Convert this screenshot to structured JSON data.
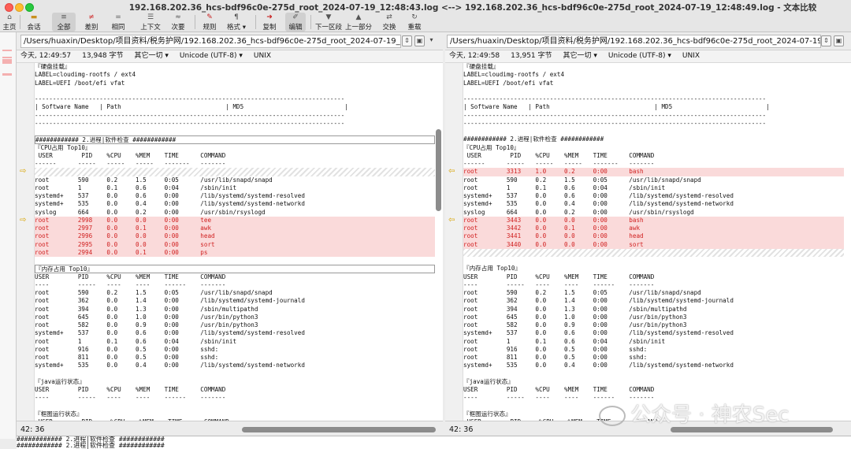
{
  "window": {
    "title": "192.168.202.36_hcs-bdf96c0e-275d_root_2024-07-19_12:48:43.log <--> 192.168.202.36_hcs-bdf96c0e-275d_root_2024-07-19_12:48:49.log - 文本比较"
  },
  "toolbar": [
    {
      "label": "主页",
      "icon": "home-icon"
    },
    {
      "label": "会话",
      "icon": "session-icon"
    },
    {
      "label": "全部",
      "icon": "all-icon"
    },
    {
      "label": "差别",
      "icon": "diff-icon"
    },
    {
      "label": "相同",
      "icon": "same-icon"
    },
    {
      "label": "上下文",
      "icon": "context-icon"
    },
    {
      "label": "次要",
      "icon": "minor-icon"
    },
    {
      "label": "规则",
      "icon": "rules-icon"
    },
    {
      "label": "格式",
      "icon": "format-icon"
    },
    {
      "label": "复制",
      "icon": "copy-icon"
    },
    {
      "label": "编辑",
      "icon": "edit-icon"
    },
    {
      "label": "下一区段",
      "icon": "next-section-icon"
    },
    {
      "label": "上一部分",
      "icon": "prev-section-icon"
    },
    {
      "label": "交换",
      "icon": "swap-icon"
    },
    {
      "label": "重载",
      "icon": "reload-icon"
    }
  ],
  "left": {
    "path": "/Users/huaxin/Desktop/项目资料/税务护网/192.168.202.36_hcs-bdf96c0e-275d_root_2024-07-19_12:48:43.log",
    "time": "今天, 12:49:57",
    "size": "13,948 字节",
    "other": "其它一切 ▾",
    "encoding": "Unicode (UTF-8) ▾",
    "eol": "UNIX",
    "cursor": "42: 36",
    "lines": [
      {
        "t": "『硬盘挂载』"
      },
      {
        "t": "LABEL=cloudimg-rootfs / ext4"
      },
      {
        "t": "LABEL=UEFI /boot/efi vfat"
      },
      {
        "t": ""
      },
      {
        "t": "--------------------------------------------------------------------------------------"
      },
      {
        "t": "| Software Name   | Path                             | MD5                            |"
      },
      {
        "t": "--------------------------------------------------------------------------------------"
      },
      {
        "t": "--------------------------------------------------------------------------------------"
      },
      {
        "t": ""
      },
      {
        "t": "############ 2.进程|软件检查 ############",
        "k": "box"
      },
      {
        "t": "『CPU占用 Top10』"
      },
      {
        "t": " USER        PID    %CPU    %MEM    TIME      COMMAND"
      },
      {
        "t": "------      -----   -----   -----   -------   -------"
      },
      {
        "t": "",
        "k": "hatch",
        "a": true
      },
      {
        "t": "root        590     0.2     1.5     0:05      /usr/lib/snapd/snapd"
      },
      {
        "t": "root        1       0.1     0.6     0:04      /sbin/init"
      },
      {
        "t": "systemd+    537     0.0     0.6     0:00      /lib/systemd/systemd-resolved"
      },
      {
        "t": "systemd+    535     0.0     0.4     0:00      /lib/systemd/systemd-networkd"
      },
      {
        "t": "syslog      664     0.0     0.2     0:00      /usr/sbin/rsyslogd"
      },
      {
        "t": "root        2998    0.0     0.0     0:00      tee",
        "k": "diff",
        "a": true
      },
      {
        "t": "root        2997    0.0     0.1     0:00      awk",
        "k": "diff"
      },
      {
        "t": "root        2996    0.0     0.0     0:00      head",
        "k": "diff"
      },
      {
        "t": "root        2995    0.0     0.0     0:00      sort",
        "k": "diff"
      },
      {
        "t": "root        2994    0.0     0.1     0:00      ps",
        "k": "diff"
      },
      {
        "t": ""
      },
      {
        "t": "『内存占用 Top10』",
        "k": "box"
      },
      {
        "t": "USER        PID     %CPU    %MEM    TIME      COMMAND"
      },
      {
        "t": "----        -----   ----    ----    ------    -------"
      },
      {
        "t": "root        590     0.2     1.5     0:05      /usr/lib/snapd/snapd"
      },
      {
        "t": "root        362     0.0     1.4     0:00      /lib/systemd/systemd-journald"
      },
      {
        "t": "root        394     0.0     1.3     0:00      /sbin/multipathd"
      },
      {
        "t": "root        645     0.0     1.0     0:00      /usr/bin/python3"
      },
      {
        "t": "root        582     0.0     0.9     0:00      /usr/bin/python3"
      },
      {
        "t": "systemd+    537     0.0     0.6     0:00      /lib/systemd/systemd-resolved"
      },
      {
        "t": "root        1       0.1     0.6     0:04      /sbin/init"
      },
      {
        "t": "root        916     0.0     0.5     0:00      sshd:"
      },
      {
        "t": "root        811     0.0     0.5     0:00      sshd:"
      },
      {
        "t": "systemd+    535     0.0     0.4     0:00      /lib/systemd/systemd-networkd"
      },
      {
        "t": ""
      },
      {
        "t": "『java运行状态』"
      },
      {
        "t": "USER        PID     %CPU    %MEM    TIME      COMMAND"
      },
      {
        "t": "----        -----   ----    ----    ------    -------"
      },
      {
        "t": ""
      },
      {
        "t": "『框图运行状态』"
      },
      {
        "t": " USER        PID     %CPU    %MEM    TIME      COMMAND"
      }
    ]
  },
  "right": {
    "path": "/Users/huaxin/Desktop/项目资料/税务护网/192.168.202.36_hcs-bdf96c0e-275d_root_2024-07-19_12:48:49.log",
    "time": "今天, 12:49:58",
    "size": "13,951 字节",
    "other": "其它一切 ▾",
    "encoding": "Unicode (UTF-8) ▾",
    "eol": "UNIX",
    "cursor": "42: 36",
    "lines": [
      {
        "t": "『硬盘挂载』"
      },
      {
        "t": "LABEL=cloudimg-rootfs / ext4"
      },
      {
        "t": "LABEL=UEFI /boot/efi vfat"
      },
      {
        "t": ""
      },
      {
        "t": "------------------------------------------------------------------------------------"
      },
      {
        "t": "| Software Name   | Path                             | MD5                          |"
      },
      {
        "t": "------------------------------------------------------------------------------------"
      },
      {
        "t": "------------------------------------------------------------------------------------"
      },
      {
        "t": ""
      },
      {
        "t": "############ 2.进程|软件检查 ############"
      },
      {
        "t": "『CPU占用 Top10』"
      },
      {
        "t": " USER        PID    %CPU    %MEM    TIME      COMMAND"
      },
      {
        "t": "------      -----   -----   -----   -------   -------"
      },
      {
        "t": "root        3313    1.0     0.2     0:00      bash",
        "k": "diff",
        "a": true
      },
      {
        "t": "root        590     0.2     1.5     0:05      /usr/lib/snapd/snapd"
      },
      {
        "t": "root        1       0.1     0.6     0:04      /sbin/init"
      },
      {
        "t": "systemd+    537     0.0     0.6     0:00      /lib/systemd/systemd-resolved"
      },
      {
        "t": "systemd+    535     0.0     0.4     0:00      /lib/systemd/systemd-networkd"
      },
      {
        "t": "syslog      664     0.0     0.2     0:00      /usr/sbin/rsyslogd"
      },
      {
        "t": "root        3443    0.0     0.0     0:00      bash",
        "k": "diff",
        "a": true
      },
      {
        "t": "root        3442    0.0     0.1     0:00      awk",
        "k": "diff"
      },
      {
        "t": "root        3441    0.0     0.0     0:00      head",
        "k": "diff"
      },
      {
        "t": "root        3440    0.0     0.0     0:00      sort",
        "k": "diff"
      },
      {
        "t": "",
        "k": "hatch"
      },
      {
        "t": ""
      },
      {
        "t": "『内存占用 Top10』"
      },
      {
        "t": "USER        PID     %CPU    %MEM    TIME      COMMAND"
      },
      {
        "t": "----        -----   ----    ----    ------    -------"
      },
      {
        "t": "root        590     0.2     1.5     0:05      /usr/lib/snapd/snapd"
      },
      {
        "t": "root        362     0.0     1.4     0:00      /lib/systemd/systemd-journald"
      },
      {
        "t": "root        394     0.0     1.3     0:00      /sbin/multipathd"
      },
      {
        "t": "root        645     0.0     1.0     0:00      /usr/bin/python3"
      },
      {
        "t": "root        582     0.0     0.9     0:00      /usr/bin/python3"
      },
      {
        "t": "systemd+    537     0.0     0.6     0:00      /lib/systemd/systemd-resolved"
      },
      {
        "t": "root        1       0.1     0.6     0:04      /sbin/init"
      },
      {
        "t": "root        916     0.0     0.5     0:00      sshd:"
      },
      {
        "t": "root        811     0.0     0.5     0:00      sshd:"
      },
      {
        "t": "systemd+    535     0.0     0.4     0:00      /lib/systemd/systemd-networkd"
      },
      {
        "t": ""
      },
      {
        "t": "『java运行状态』"
      },
      {
        "t": "USER        PID     %CPU    %MEM    TIME      COMMAND"
      },
      {
        "t": "----        -----   ----    ----    ------    -------"
      },
      {
        "t": ""
      },
      {
        "t": "『框图运行状态』"
      },
      {
        "t": " USER        PID     %CPU    %MEM    TIME      COMMAND"
      }
    ]
  },
  "bottom": [
    "############ 2.进程|软件检查 ############",
    "############ 2.进程|软件检查 ############"
  ],
  "watermark": "公众号 · 神农Sec",
  "colors": {
    "diff_bg": "#fadada",
    "diff_text": "#d02020",
    "arrow": "#d9a400"
  }
}
